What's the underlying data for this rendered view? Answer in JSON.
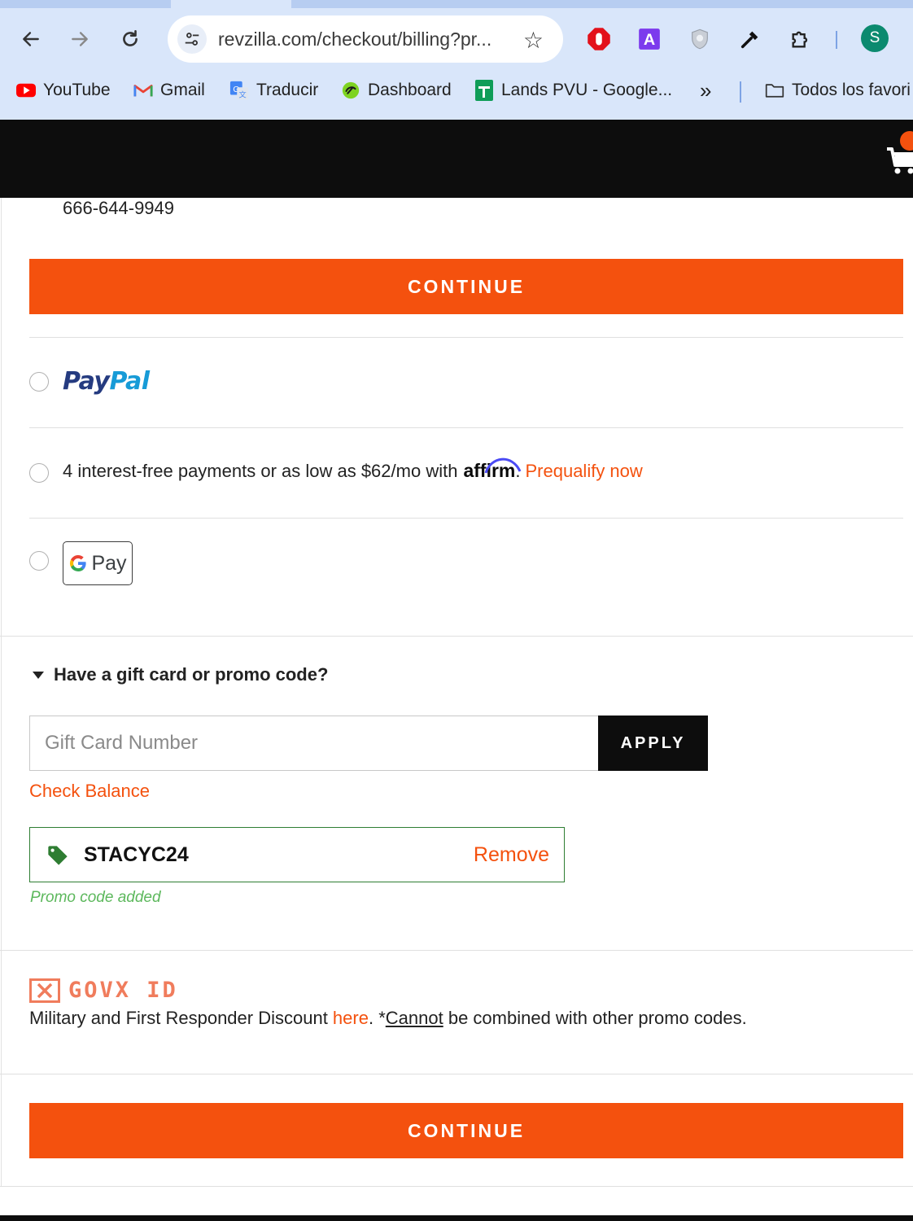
{
  "browser": {
    "url": "revzilla.com/checkout/billing?pr...",
    "profile_initial": "S",
    "bookmarks": [
      {
        "label": "YouTube",
        "icon": "youtube-icon"
      },
      {
        "label": "Gmail",
        "icon": "gmail-icon"
      },
      {
        "label": "Traducir",
        "icon": "translate-icon"
      },
      {
        "label": "Dashboard",
        "icon": "dashboard-icon"
      },
      {
        "label": "Lands PVU - Google...",
        "icon": "sheets-icon"
      }
    ],
    "more_bookmarks": "»",
    "all_bookmarks": "Todos los favori"
  },
  "checkout": {
    "phone": "666-644-9949",
    "continue_label": "CONTINUE",
    "payment_options": {
      "paypal_pay": "Pay",
      "paypal_pal": "Pal",
      "affirm_text": "4 interest-free payments or as low as $62/mo with",
      "affirm_brand": "affirm",
      "affirm_period": ".",
      "affirm_link": "Prequalify now",
      "gpay_label": "Pay"
    },
    "promo": {
      "toggle_label": "Have a gift card or promo code?",
      "input_placeholder": "Gift Card Number",
      "apply_label": "APPLY",
      "check_balance": "Check Balance",
      "applied_code": "STACYC24",
      "remove_label": "Remove",
      "status": "Promo code added"
    },
    "govx": {
      "logo_text": "GOVX ID",
      "text_before": "Military and First Responder Discount ",
      "link": "here",
      "text_mid": ". *",
      "cannot": "Cannot",
      "text_after": " be combined with other promo codes."
    }
  },
  "colors": {
    "accent": "#f4510e",
    "header_bg": "#0d0d0d",
    "success": "#2e7d32"
  }
}
